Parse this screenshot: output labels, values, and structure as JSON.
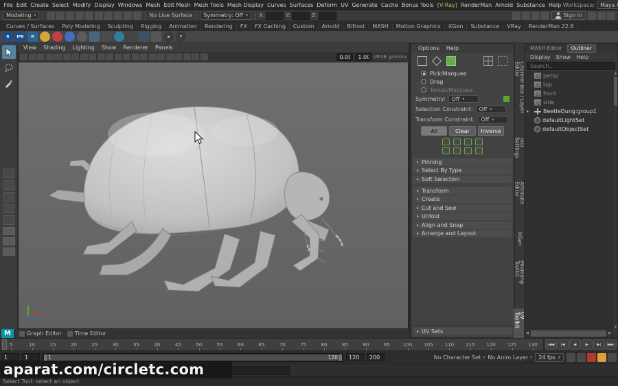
{
  "menubar": {
    "items": [
      "File",
      "Edit",
      "Create",
      "Select",
      "Modify",
      "Display",
      "Windows",
      "Mesh",
      "Edit Mesh",
      "Mesh Tools",
      "Mesh Display",
      "Curves",
      "Surfaces",
      "Deform",
      "UV",
      "Generate",
      "Cache",
      "Bonus Tools",
      {
        "label": "[V-Ray]",
        "cls": "vray"
      },
      "RenderMan",
      "Arnold",
      "Substance",
      "Help"
    ],
    "workspace_label": "Workspace:",
    "workspace_value": "Maya Classic*"
  },
  "toolbar": {
    "mode": "Modeling",
    "left_icons": [
      {
        "name": "new-scene-icon"
      },
      {
        "name": "open-scene-icon"
      },
      {
        "name": "save-scene-icon"
      },
      {
        "name": "undo-icon"
      },
      {
        "name": "redo-icon"
      },
      {
        "name": "snap-grid-icon"
      },
      {
        "name": "snap-curve-icon"
      },
      {
        "name": "snap-point-icon"
      },
      {
        "name": "snap-projected-center-icon"
      },
      {
        "name": "make-live-icon"
      }
    ],
    "no_live_surface": "No Live Surface",
    "symmetry": "Symmetry: Off",
    "axis": [
      {
        "label": "X:",
        "value": ""
      },
      {
        "label": "Y:",
        "value": ""
      },
      {
        "label": "Z:",
        "value": ""
      }
    ],
    "right_icons": [
      {
        "name": "render-view-icon"
      },
      {
        "name": "ipr-render-icon"
      },
      {
        "name": "render-settings-icon"
      },
      {
        "name": "display-layer-icon"
      }
    ],
    "sign_in": "Sign In",
    "far_right_icons": [
      {
        "name": "single-pane-layout-icon"
      },
      {
        "name": "four-pane-layout-icon"
      },
      {
        "name": "hotbox-icon"
      }
    ]
  },
  "shelf": {
    "tabs": [
      "Curves / Surfaces",
      "Poly Modeling",
      "Sculpting",
      "Rigging",
      "Animation",
      "Rendering",
      "FX",
      "FX Caching",
      "Custom",
      "Arnold",
      "Bifrost",
      "MASH",
      "Motion Graphics",
      "XGen",
      "Substance",
      "VRay",
      "RenderMan 22.6"
    ],
    "icons": [
      {
        "name": "renderman-render-icon",
        "c": "#1d4e89",
        "t": "R"
      },
      {
        "name": "renderman-ipr-icon",
        "c": "#1d4e89",
        "t": "IPR"
      },
      {
        "name": "renderman-preview-icon",
        "c": "#2a6496",
        "t": "R"
      },
      {
        "name": "sphere-yellow-icon",
        "c": "#d2a63c",
        "round": true
      },
      {
        "name": "sphere-red-icon",
        "c": "#bf4040",
        "round": true
      },
      {
        "name": "sphere-blue-icon",
        "c": "#3f6fbf",
        "round": true
      },
      {
        "name": "gear-icon",
        "c": "#5c5c5c",
        "round": true
      },
      {
        "name": "node-network-icon",
        "c": "#46657f"
      },
      {
        "name": "texture-icon",
        "c": "#4a4a4a"
      },
      {
        "name": "globe-icon",
        "c": "#2f7f9f",
        "round": true
      },
      {
        "name": "camera-shelf-icon",
        "c": "#444444"
      },
      {
        "name": "graph-icon",
        "c": "#3d5166"
      },
      {
        "name": "light-shelf-icon",
        "c": "#555555"
      },
      {
        "name": "close-round-icon",
        "c": "#3a3a3a",
        "t": "x",
        "round": true
      },
      {
        "name": "help-round-icon",
        "c": "#3a3a3a",
        "t": "?",
        "round": true
      }
    ]
  },
  "viewport": {
    "menus": [
      "View",
      "Shading",
      "Lighting",
      "Show",
      "Renderer",
      "Panels"
    ],
    "toolbar_icons": [
      {
        "name": "select-camera-icon"
      },
      {
        "name": "lock-camera-icon"
      },
      {
        "name": "camera-attributes-icon"
      },
      {
        "name": "bookmark-icon"
      },
      {
        "name": "image-plane-icon"
      },
      {
        "name": "2d-pan-zoom-icon"
      },
      {
        "name": "oscilloscope-icon"
      },
      {
        "name": "film-gate-icon"
      },
      {
        "name": "resolution-gate-icon"
      },
      {
        "name": "gate-mask-icon"
      },
      {
        "name": "field-chart-icon"
      },
      {
        "name": "safe-action-icon"
      },
      {
        "name": "safe-title-icon"
      },
      {
        "name": "wireframe-icon"
      },
      {
        "name": "shaded-icon"
      },
      {
        "name": "textured-icon"
      },
      {
        "name": "use-all-lights-icon"
      },
      {
        "name": "shadows-icon"
      },
      {
        "name": "screen-space-ao-icon"
      },
      {
        "name": "motion-blur-icon"
      },
      {
        "name": "multisample-icon"
      },
      {
        "name": "isolate-select-icon"
      }
    ],
    "exposure": "0.00",
    "gamma": "1.00",
    "colorspace": "sRGB gamma"
  },
  "uv_toolkit": {
    "menus": [
      "Options",
      "Help"
    ],
    "modes": [
      {
        "label": "Pick/Marquee",
        "selected": true
      },
      {
        "label": "Drag"
      },
      {
        "label": "Tweak/Marquee",
        "dim": true
      }
    ],
    "symmetry_label": "Symmetry:",
    "symmetry_value": "Off",
    "sel_constraint_label": "Selection Constraint:",
    "sel_constraint_value": "Off",
    "tf_constraint_label": "Transform Constraint:",
    "tf_constraint_value": "Off",
    "buttons": [
      {
        "label": "All",
        "cls": "primary"
      },
      {
        "label": "Clear"
      },
      {
        "label": "Inverse"
      }
    ],
    "sections": [
      "Pinning",
      "Select By Type",
      "Soft Selection",
      {
        "label": "Transform",
        "cls": "gap"
      },
      "Create",
      "Cut and Sew",
      "Unfold",
      "Align and Snap",
      "Arrange and Layout"
    ],
    "uv_sets": "UV Sets"
  },
  "right_tabs": [
    {
      "label": "Channel Box / Layer Editor"
    },
    {
      "label": "Tool Settings"
    },
    {
      "label": "Attribute Editor"
    },
    {
      "label": "XGen"
    },
    {
      "label": "Modeling Toolkit"
    },
    {
      "label": "UV Toolkit",
      "active": true
    }
  ],
  "outliner": {
    "tabs": [
      {
        "label": "MASH Editor"
      },
      {
        "label": "Outliner",
        "active": true
      }
    ],
    "menus": [
      "Display",
      "Show",
      "Help"
    ],
    "search_placeholder": "Search...",
    "items": [
      {
        "label": "persp",
        "cls": "cam",
        "dim": true
      },
      {
        "label": "top",
        "cls": "cam",
        "dim": true
      },
      {
        "label": "front",
        "cls": "cam",
        "dim": true
      },
      {
        "label": "side",
        "cls": "cam",
        "dim": true
      },
      {
        "label": "BeetleDung:group1",
        "cls": "grp",
        "expand": true
      },
      {
        "label": "defaultLightSet",
        "cls": "set"
      },
      {
        "label": "defaultObjectSet",
        "cls": "set"
      }
    ]
  },
  "panel_tabs": [
    "Graph Editor",
    "Time Editor"
  ],
  "logo": {
    "maya": "M"
  },
  "timeline": {
    "ticks": [
      5,
      10,
      15,
      20,
      25,
      30,
      35,
      40,
      45,
      50,
      55,
      60,
      65,
      70,
      75,
      80,
      85,
      90,
      95,
      100,
      105,
      110,
      115,
      120,
      125,
      130
    ]
  },
  "playback": {
    "anim_start": "1",
    "play_start": "1",
    "range_start_label": "1",
    "range_end_label": "120",
    "play_end": "120",
    "anim_end": "200",
    "character_set": "No Character Set",
    "anim_layer": "No Anim Layer",
    "fps": "24 fps",
    "controls": [
      "|◀◀",
      "|◀",
      "◀",
      "▶",
      "▶|",
      "▶▶|"
    ],
    "icons": [
      {
        "name": "playback-option-icon",
        "c": "#4a4a4a"
      },
      {
        "name": "snap-keys-icon",
        "c": "#4a4a4a"
      },
      {
        "name": "auto-key-icon",
        "c": "#b03a2e"
      },
      {
        "name": "animation-preferences-icon",
        "c": "#d8a13a"
      },
      {
        "name": "preferences-gear-icon",
        "c": "#4a4a4a"
      }
    ]
  },
  "watermark": {
    "text": "aparat.com/circletc.com"
  },
  "statusbar": {
    "text": "Select Tool: select an object"
  }
}
